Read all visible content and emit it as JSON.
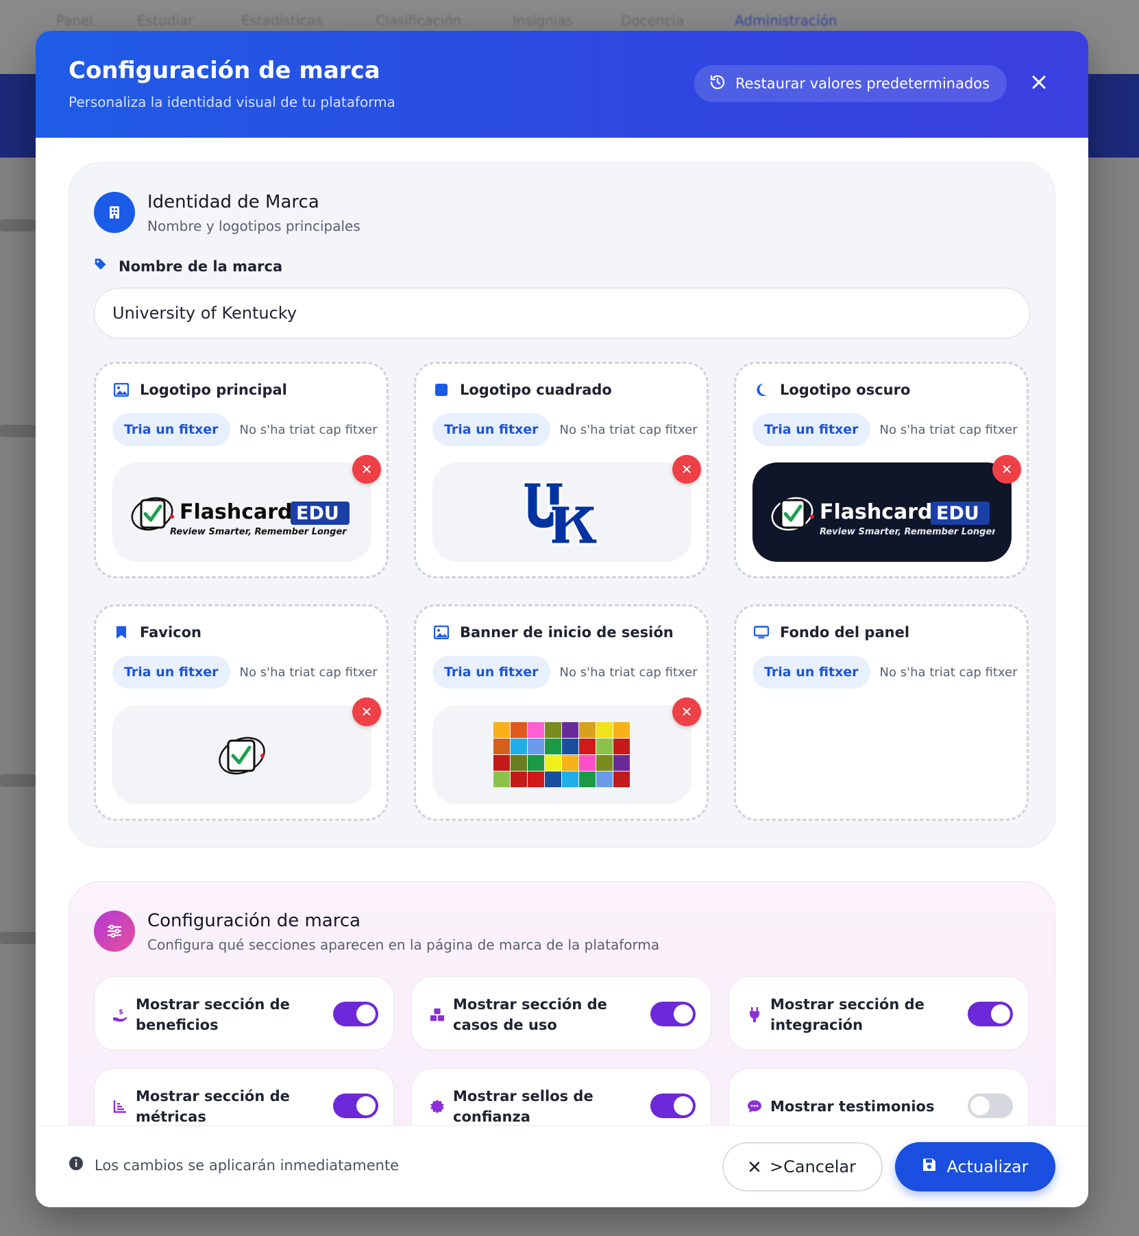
{
  "background": {
    "nav_items": [
      "Panel",
      "Estudiar",
      "Estadísticas",
      "Clasificación",
      "Insignias",
      "Docencia",
      "Administración"
    ]
  },
  "header": {
    "title": "Configuración de marca",
    "subtitle": "Personaliza la identidad visual de tu plataforma",
    "restore_label": "Restaurar valores predeterminados",
    "close_icon": "close-icon"
  },
  "identity": {
    "title": "Identidad de Marca",
    "subtitle": "Nombre y logotipos principales",
    "name_label": "Nombre de la marca",
    "name_value": "University of Kentucky",
    "cards": [
      {
        "label": "Logotipo principal",
        "icon": "image-icon",
        "button": "Tria un fitxer",
        "status": "No s'ha triat cap fitxer",
        "preview": "flashcard-edu-logo"
      },
      {
        "label": "Logotipo cuadrado",
        "icon": "square-icon",
        "button": "Tria un fitxer",
        "status": "No s'ha triat cap fitxer",
        "preview": "uk-logo"
      },
      {
        "label": "Logotipo oscuro",
        "icon": "moon-icon",
        "button": "Tria un fitxer",
        "status": "No s'ha triat cap fitxer",
        "preview": "flashcard-edu-logo-dark"
      },
      {
        "label": "Favicon",
        "icon": "bookmark-icon",
        "button": "Tria un fitxer",
        "status": "No s'ha triat cap fitxer",
        "preview": "favicon"
      },
      {
        "label": "Banner de inicio de sesión",
        "icon": "image-icon",
        "button": "Tria un fitxer",
        "status": "No s'ha triat cap fitxer",
        "preview": "color-grid-banner"
      },
      {
        "label": "Fondo del panel",
        "icon": "monitor-icon",
        "button": "Tria un fitxer",
        "status": "No s'ha triat cap fitxer",
        "preview": ""
      }
    ],
    "logo_text": {
      "brand": "Flashcard",
      "edu": "EDU",
      "tagline": "Review Smarter, Remember Longer"
    }
  },
  "brand_config": {
    "title": "Configuración de marca",
    "subtitle": "Configura qué secciones aparecen en la página de marca de la plataforma",
    "toggles": [
      {
        "label": "Mostrar sección de beneficios",
        "icon": "hand-coin-icon",
        "on": true
      },
      {
        "label": "Mostrar sección de casos de uso",
        "icon": "boxes-icon",
        "on": true
      },
      {
        "label": "Mostrar sección de integración",
        "icon": "plug-icon",
        "on": true
      },
      {
        "label": "Mostrar sección de métricas",
        "icon": "chart-icon",
        "on": true
      },
      {
        "label": "Mostrar sellos de confianza",
        "icon": "badge-icon",
        "on": true
      },
      {
        "label": "Mostrar testimonios",
        "icon": "chat-icon",
        "on": false
      }
    ]
  },
  "footer": {
    "note": "Los cambios se aplicarán inmediatamente",
    "cancel_label": ">Cancelar",
    "update_label": "Actualizar"
  },
  "colors": {
    "primary": "#1a4fdf",
    "accent_purple": "#6d28d9",
    "danger": "#ef4047",
    "uk_blue": "#0033a0"
  }
}
